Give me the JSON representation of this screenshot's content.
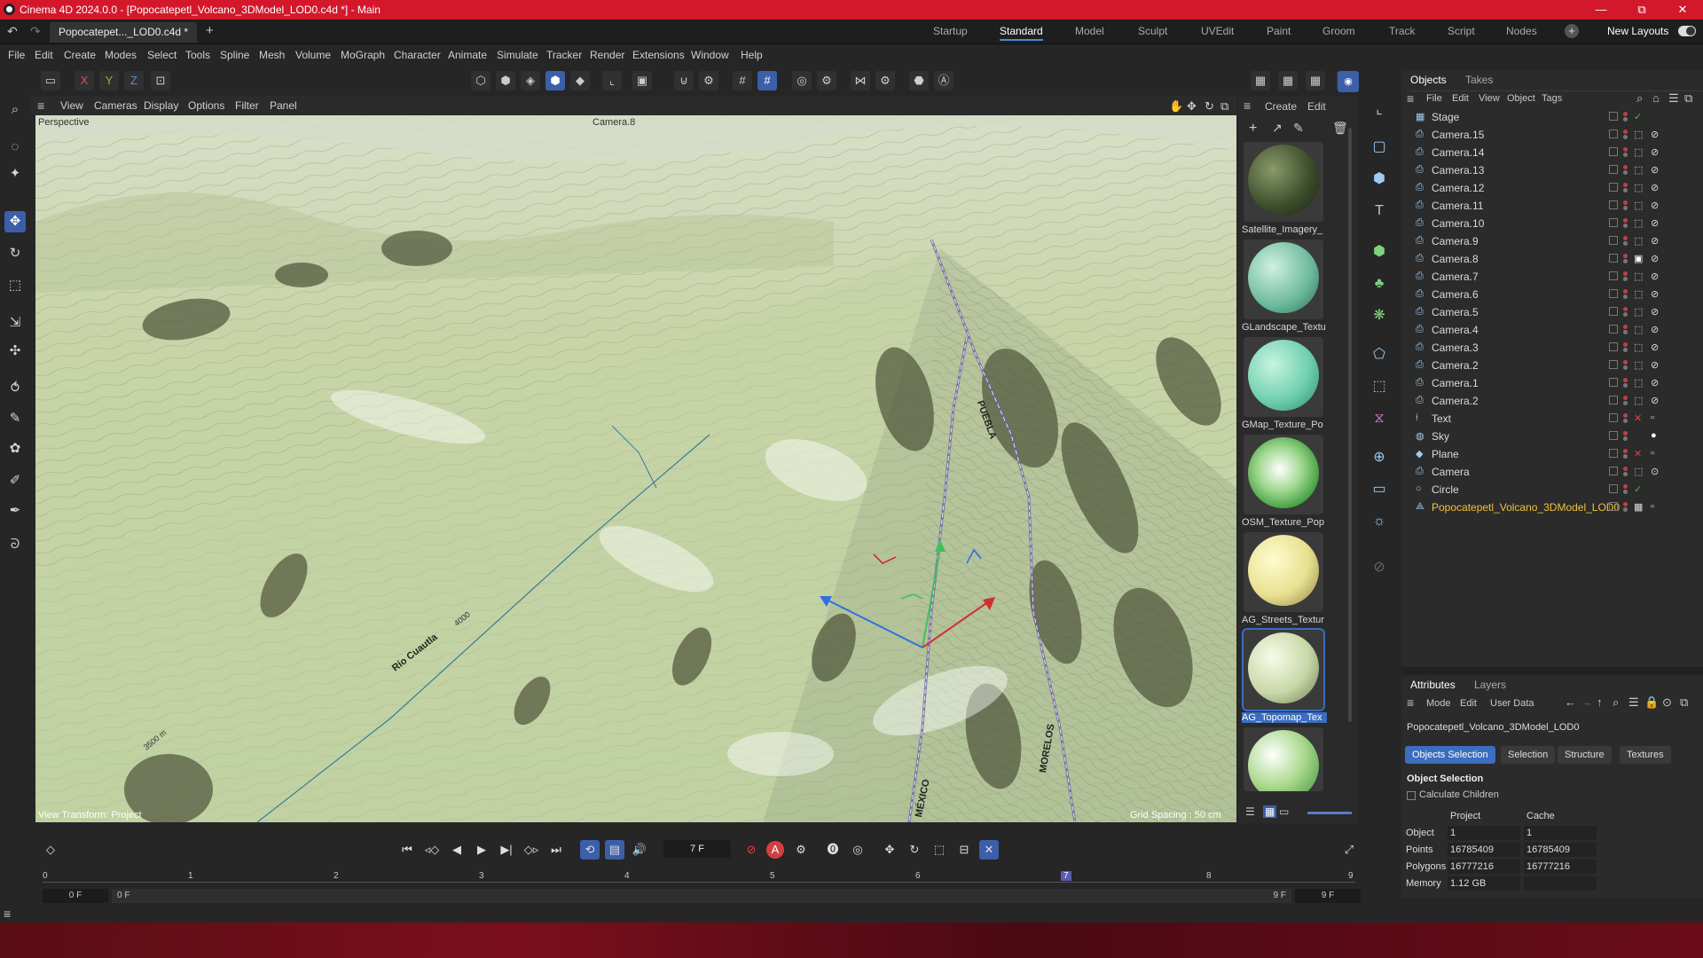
{
  "titlebar": {
    "title": "Cinema 4D 2024.0.0 - [Popocatepetl_Volcano_3DModel_LOD0.c4d *] - Main",
    "minimize": "—",
    "maximize": "⧉",
    "close": "✕"
  },
  "tabs": {
    "doc_tab": "Popocatepet..._LOD0.c4d *",
    "add": "+",
    "undo": "↶",
    "redo": "↷"
  },
  "layouts": {
    "items": [
      "Startup",
      "Standard",
      "Model",
      "Sculpt",
      "UVEdit",
      "Paint",
      "Groom",
      "Track",
      "Script",
      "Nodes"
    ],
    "active": "Standard",
    "new_layouts": "New Layouts"
  },
  "menu": {
    "items": [
      "File",
      "Edit",
      "Create",
      "Modes",
      "Select",
      "Tools",
      "Spline",
      "Mesh",
      "Volume",
      "MoGraph",
      "Character",
      "Animate",
      "Simulate",
      "Tracker",
      "Render",
      "Extensions",
      "Window",
      "Help"
    ]
  },
  "toolbar": {
    "x": "X",
    "y": "Y",
    "z": "Z"
  },
  "viewport": {
    "menu": [
      "View",
      "Cameras",
      "Display",
      "Options",
      "Filter",
      "Panel"
    ],
    "label_perspective": "Perspective",
    "label_camera": "Camera.8",
    "label_transform": "View Transform: Project",
    "label_grid": "Grid Spacing : 50 cm",
    "label_mexico": "MÉXICO",
    "label_morelos": "MORELOS",
    "label_puebla": "PUEBLA",
    "label_rio": "Río Cuautla",
    "label_4000": "4000",
    "label_3500": "3500 m"
  },
  "materials": {
    "menu": [
      "Create",
      "Edit"
    ],
    "items": [
      {
        "name": "Satellite_Imagery_"
      },
      {
        "name": "GLandscape_Textu"
      },
      {
        "name": "GMap_Texture_Po"
      },
      {
        "name": "OSM_Texture_Pop"
      },
      {
        "name": "AG_Streets_Textur"
      },
      {
        "name": "AG_Topomap_Tex"
      },
      {
        "name": ""
      }
    ]
  },
  "objects": {
    "tabs": [
      "Objects",
      "Takes"
    ],
    "menu": [
      "File",
      "Edit",
      "View",
      "Object",
      "Tags"
    ],
    "rows": [
      {
        "name": "Stage"
      },
      {
        "name": "Camera.15"
      },
      {
        "name": "Camera.14"
      },
      {
        "name": "Camera.13"
      },
      {
        "name": "Camera.12"
      },
      {
        "name": "Camera.11"
      },
      {
        "name": "Camera.10"
      },
      {
        "name": "Camera.9"
      },
      {
        "name": "Camera.8"
      },
      {
        "name": "Camera.7"
      },
      {
        "name": "Camera.6"
      },
      {
        "name": "Camera.5"
      },
      {
        "name": "Camera.4"
      },
      {
        "name": "Camera.3"
      },
      {
        "name": "Camera.2"
      },
      {
        "name": "Camera.1"
      },
      {
        "name": "Camera.2"
      },
      {
        "name": "Text"
      },
      {
        "name": "Sky"
      },
      {
        "name": "Plane"
      },
      {
        "name": "Camera"
      },
      {
        "name": "Circle"
      },
      {
        "name": "Popocatepetl_Volcano_3DModel_LOD0"
      }
    ]
  },
  "attributes": {
    "tabs": [
      "Attributes",
      "Layers"
    ],
    "menu": [
      "Mode",
      "Edit",
      "User Data"
    ],
    "object_name": "Popocatepetl_Volcano_3DModel_LOD0",
    "buttons": [
      "Objects Selection",
      "Selection",
      "Structure",
      "Textures"
    ],
    "section": "Object Selection",
    "calc_children": "Calculate Children",
    "col_project": "Project",
    "col_cache": "Cache",
    "rows": [
      {
        "label": "Object",
        "project": "1",
        "cache": "1"
      },
      {
        "label": "Points",
        "project": "16785409",
        "cache": "16785409"
      },
      {
        "label": "Polygons",
        "project": "16777216",
        "cache": "16777216"
      },
      {
        "label": "Memory",
        "project": "1.12 GB",
        "cache": ""
      }
    ]
  },
  "timeline": {
    "current_frame": "7 F",
    "ticks": [
      "0",
      "1",
      "2",
      "3",
      "4",
      "5",
      "6",
      "7",
      "8",
      "9"
    ],
    "start": "0 F",
    "start2": "0 F",
    "end": "9 F",
    "end2": "9 F"
  },
  "colors": {
    "accent": "#3b5fa8",
    "titlebar": "#d3182c",
    "terrain": "#c8d6a8"
  }
}
